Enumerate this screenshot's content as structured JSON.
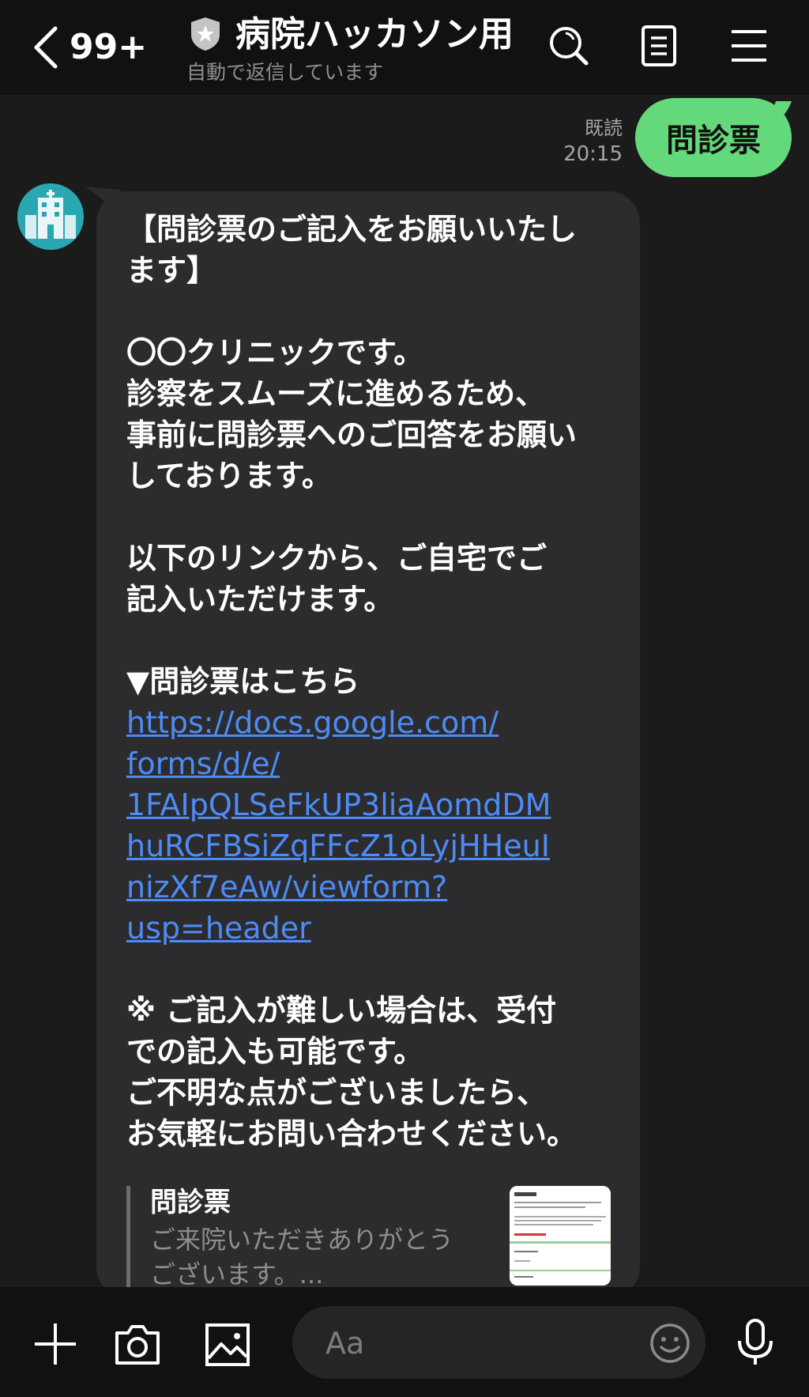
{
  "header": {
    "back_count": "99+",
    "title": "病院ハッカソン用",
    "subtitle": "自動で返信しています",
    "icons": [
      "chevron-left-icon",
      "shield-icon",
      "search-icon",
      "notes-icon",
      "menu-icon"
    ]
  },
  "sent_message": {
    "text": "問診票",
    "read_label": "既読",
    "time": "20:15",
    "bubble_color": "#64d97b"
  },
  "received_message": {
    "paragraphs_before_link": "【問診票のご記入をお願いいたし\nます】\n\n〇〇クリニックです。\n診察をスムーズに進めるため、\n事前に問診票へのご回答をお願い\nしております。\n\n以下のリンクから、ご自宅でご\n記入いただけます。\n\n▼問診票はこちら",
    "link": "https://docs.google.com/\nforms/d/e/\n1FAIpQLSeFkUP3liaAomdDM\nhuRCFBSiZqFFcZ1oLyjHHeuI\nnizXf7eAw/viewform?\nusp=header",
    "paragraphs_after_link": "\n※ ご記入が難しい場合は、受付\nでの記入も可能です。\nご不明な点がございましたら、\nお気軽にお問い合わせください。",
    "link_color": "#4d8cf5",
    "bubble_color": "#2c2c2e"
  },
  "link_preview": {
    "title": "問診票",
    "description": "ご来院いただきありがとう\nございます。..."
  },
  "bottom_bar": {
    "input_placeholder": "Aa",
    "icons": [
      "plus-icon",
      "camera-icon",
      "image-icon",
      "emoji-icon",
      "microphone-icon"
    ]
  }
}
